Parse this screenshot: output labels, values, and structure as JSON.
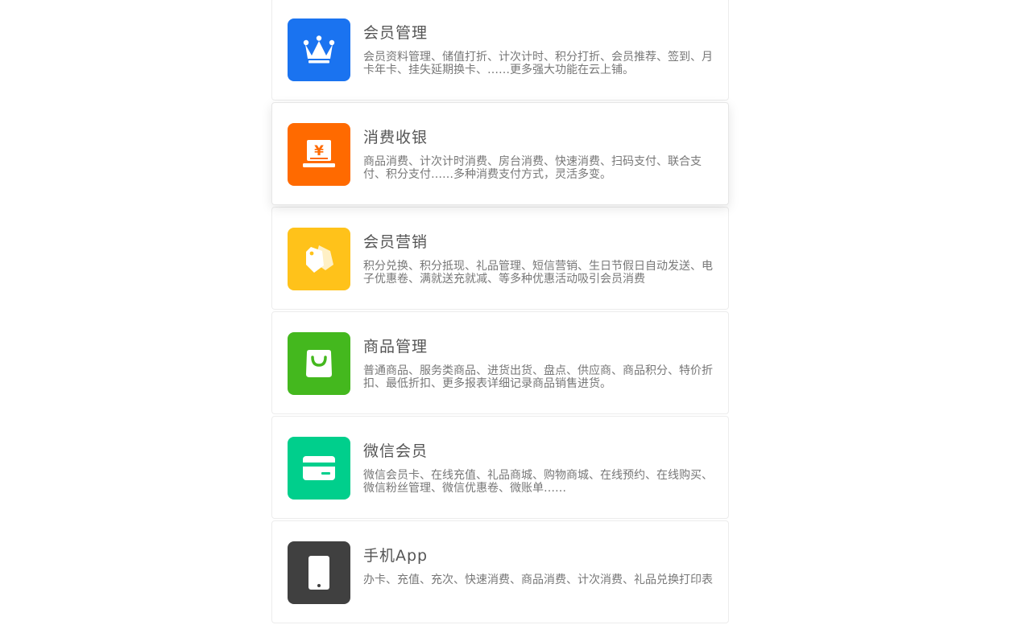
{
  "features": [
    {
      "title": "会员管理",
      "desc": "会员资料管理、储值打折、计次计时、积分打折、会员推荐、签到、月卡年卡、挂失延期换卡、……更多强大功能在云上铺。",
      "icon": "crown-icon",
      "color": "#1a73f0"
    },
    {
      "title": "消费收银",
      "desc": "商品消费、计次计时消费、房台消费、快速消费、扫码支付、联合支付、积分支付……多种消费支付方式，灵活多变。",
      "icon": "cashier-icon",
      "color": "#ff6a00"
    },
    {
      "title": "会员营销",
      "desc": "积分兑换、积分抵现、礼品管理、短信营销、生日节假日自动发送、电子优惠卷、满就送充就减、等多种优惠活动吸引会员消费",
      "icon": "tags-icon",
      "color": "#ffc21a"
    },
    {
      "title": "商品管理",
      "desc": "普通商品、服务类商品、进货出货、盘点、供应商、商品积分、特价折扣、最低折扣、更多报表详细记录商品销售进货。",
      "icon": "shopping-bag-icon",
      "color": "#44b81e"
    },
    {
      "title": "微信会员",
      "desc": "微信会员卡、在线充值、礼品商城、购物商城、在线预约、在线购买、微信粉丝管理、微信优惠卷、微账单……",
      "icon": "card-icon",
      "color": "#00cf8c"
    },
    {
      "title": "手机App",
      "desc": "办卡、充值、充次、快速消费、商品消费、计次消费、礼品兑换打印表",
      "icon": "phone-icon",
      "color": "#404040"
    }
  ]
}
